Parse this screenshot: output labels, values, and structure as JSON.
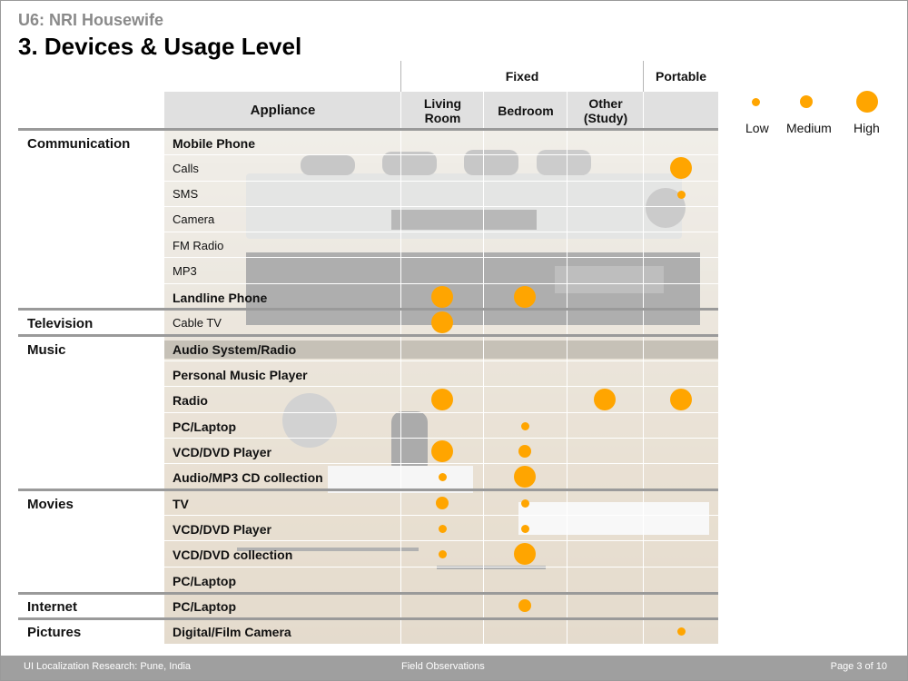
{
  "header": {
    "subtitle": "U6: NRI Housewife",
    "title": "3. Devices & Usage Level"
  },
  "table": {
    "group_fixed": "Fixed",
    "group_portable": "Portable",
    "col_appliance": "Appliance",
    "col_living_room": "Living Room",
    "col_bedroom": "Bedroom",
    "col_other": "Other (Study)",
    "categories": [
      "Communication",
      "Television",
      "Music",
      "Movies",
      "Internet",
      "Pictures"
    ],
    "rows": [
      {
        "label": "Mobile Phone",
        "living": "",
        "bedroom": "",
        "other": "",
        "portable": ""
      },
      {
        "label": "Calls",
        "living": "",
        "bedroom": "",
        "other": "",
        "portable": "high"
      },
      {
        "label": "SMS",
        "living": "",
        "bedroom": "",
        "other": "",
        "portable": "low"
      },
      {
        "label": "Camera",
        "living": "",
        "bedroom": "",
        "other": "",
        "portable": ""
      },
      {
        "label": "FM Radio",
        "living": "",
        "bedroom": "",
        "other": "",
        "portable": ""
      },
      {
        "label": "MP3",
        "living": "",
        "bedroom": "",
        "other": "",
        "portable": ""
      },
      {
        "label": "Landline Phone",
        "living": "high",
        "bedroom": "high",
        "other": "",
        "portable": ""
      },
      {
        "label": "Cable TV",
        "living": "high",
        "bedroom": "",
        "other": "",
        "portable": ""
      },
      {
        "label": "Audio System/Radio",
        "living": "",
        "bedroom": "",
        "other": "",
        "portable": ""
      },
      {
        "label": "Personal Music Player",
        "living": "",
        "bedroom": "",
        "other": "",
        "portable": ""
      },
      {
        "label": "Radio",
        "living": "high",
        "bedroom": "",
        "other": "high",
        "portable": "high"
      },
      {
        "label": "PC/Laptop",
        "living": "",
        "bedroom": "low",
        "other": "",
        "portable": ""
      },
      {
        "label": "VCD/DVD Player",
        "living": "high",
        "bedroom": "medium",
        "other": "",
        "portable": ""
      },
      {
        "label": "Audio/MP3 CD collection",
        "living": "low",
        "bedroom": "high",
        "other": "",
        "portable": ""
      },
      {
        "label": "TV",
        "living": "medium",
        "bedroom": "low",
        "other": "",
        "portable": ""
      },
      {
        "label": "VCD/DVD Player",
        "living": "low",
        "bedroom": "low",
        "other": "",
        "portable": ""
      },
      {
        "label": "VCD/DVD collection",
        "living": "low",
        "bedroom": "high",
        "other": "",
        "portable": ""
      },
      {
        "label": "PC/Laptop",
        "living": "",
        "bedroom": "",
        "other": "",
        "portable": ""
      },
      {
        "label": "PC/Laptop",
        "living": "",
        "bedroom": "medium",
        "other": "",
        "portable": ""
      },
      {
        "label": "Digital/Film Camera",
        "living": "",
        "bedroom": "",
        "other": "",
        "portable": "low"
      }
    ]
  },
  "legend": {
    "low": "Low",
    "medium": "Medium",
    "high": "High",
    "color": "#ffa500"
  },
  "footer": {
    "left": "UI Localization Research: Pune, India",
    "center": "Field Observations",
    "right": "Page 3 of 10"
  }
}
